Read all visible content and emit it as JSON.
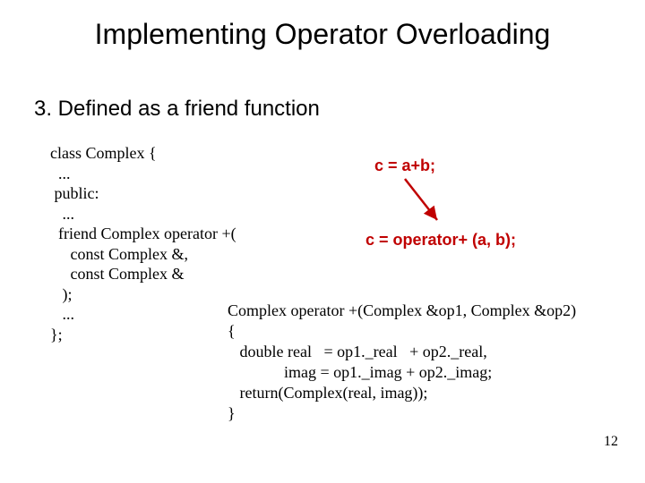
{
  "title": "Implementing Operator Overloading",
  "subheading": "3.  Defined as a friend function",
  "code_left": "class Complex {\n  ...\n public:\n   ...\n  friend Complex operator +(\n     const Complex &,\n     const Complex &\n   );\n   ...\n};",
  "expr_call": "c = a+b;",
  "expr_expanded": "c = operator+ (a, b);",
  "code_bottom": "Complex operator +(Complex &op1, Complex &op2)\n{\n   double real   = op1._real   + op2._real,\n              imag = op1._imag + op2._imag;\n   return(Complex(real, imag));\n}",
  "page_number": "12"
}
